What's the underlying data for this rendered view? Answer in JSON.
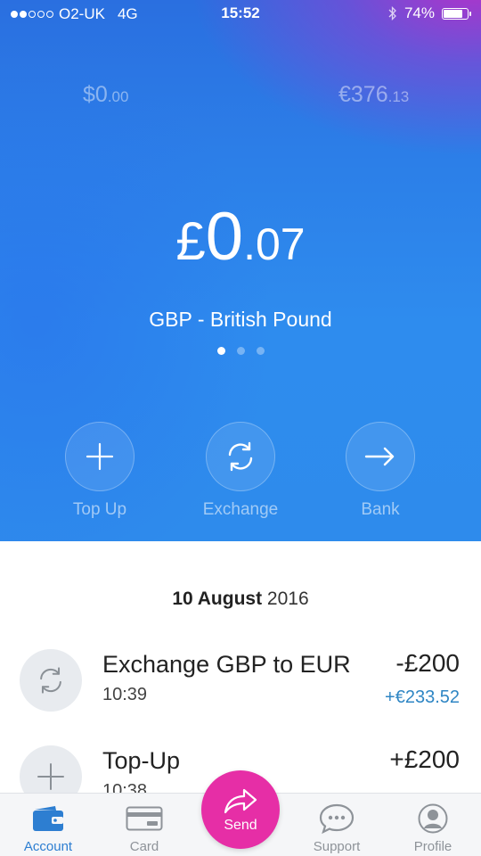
{
  "status_bar": {
    "carrier": "O2-UK",
    "network": "4G",
    "time": "15:52",
    "battery_percent": "74%",
    "battery_level": 0.74,
    "signal_bars_filled": 2,
    "signal_bars_total": 5
  },
  "balances": {
    "left": {
      "main": "$0",
      "fraction": ".00"
    },
    "right": {
      "main": "€376",
      "fraction": ".13"
    },
    "current": {
      "symbol": "£",
      "whole": "0",
      "fraction": ".07",
      "currency_name": "GBP - British Pound"
    },
    "page_count": 3,
    "active_page": 0
  },
  "actions": {
    "top_up": "Top Up",
    "exchange": "Exchange",
    "bank": "Bank"
  },
  "transactions": {
    "date_bold": "10 August",
    "date_year": "2016",
    "items": [
      {
        "title": "Exchange GBP to EUR",
        "time": "10:39",
        "amount": "-£200",
        "sub_amount": "+€233.52",
        "icon": "exchange-icon"
      },
      {
        "title": "Top-Up",
        "time": "10:38",
        "amount": "+£200",
        "icon": "plus-icon"
      }
    ]
  },
  "tabs": {
    "account": "Account",
    "card": "Card",
    "send": "Send",
    "support": "Support",
    "profile": "Profile"
  },
  "colors": {
    "accent_blue": "#2d7ed1",
    "send_pink": "#e62ea6",
    "positive_amount": "#2f86c4"
  }
}
